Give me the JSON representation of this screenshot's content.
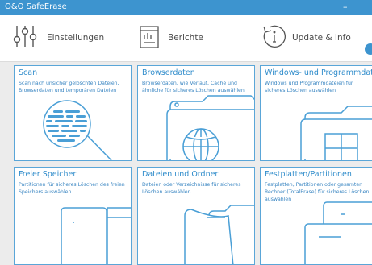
{
  "window": {
    "title": "O&O SafeErase",
    "minimize_glyph": "–"
  },
  "toolbar": {
    "items": [
      {
        "label": "Einstellungen",
        "icon": "settings-sliders-icon"
      },
      {
        "label": "Berichte",
        "icon": "reports-icon"
      },
      {
        "label": "Update & Info",
        "icon": "update-info-icon"
      }
    ]
  },
  "tiles": [
    {
      "title": "Scan",
      "description": "Scan nach unsicher gelöschten Dateien, Browserdaten und temporären Dateien",
      "icon": "magnifier-icon"
    },
    {
      "title": "Browserdaten",
      "description": "Browserdaten, wie Verlauf, Cache und ähnliche für sicheres Löschen auswählen",
      "icon": "browser-globe-icon"
    },
    {
      "title": "Windows- und Programmdaten",
      "description": "Windows und Programmdateien für sicheres Löschen auswählen",
      "icon": "windows-folder-icon"
    },
    {
      "title": "Freier Speicher",
      "description": "Partitionen für sicheres Löschen des freien Speichers auswählen",
      "icon": "free-space-drive-icon"
    },
    {
      "title": "Dateien und Ordner",
      "description": "Dateien oder Verzeichnisse für sicheres Löschen auswählen",
      "icon": "files-folders-icon"
    },
    {
      "title": "Festplatten/Partitionen",
      "description": "Festplatten, Partitionen oder gesamten Rechner (TotalErase) für sicheres Löschen auswählen",
      "icon": "hard-disk-icon"
    }
  ],
  "colors": {
    "accent": "#3d94cf",
    "tile_text": "#2f8ccb",
    "art_stroke": "#4a9fd6",
    "background": "#ececec"
  }
}
